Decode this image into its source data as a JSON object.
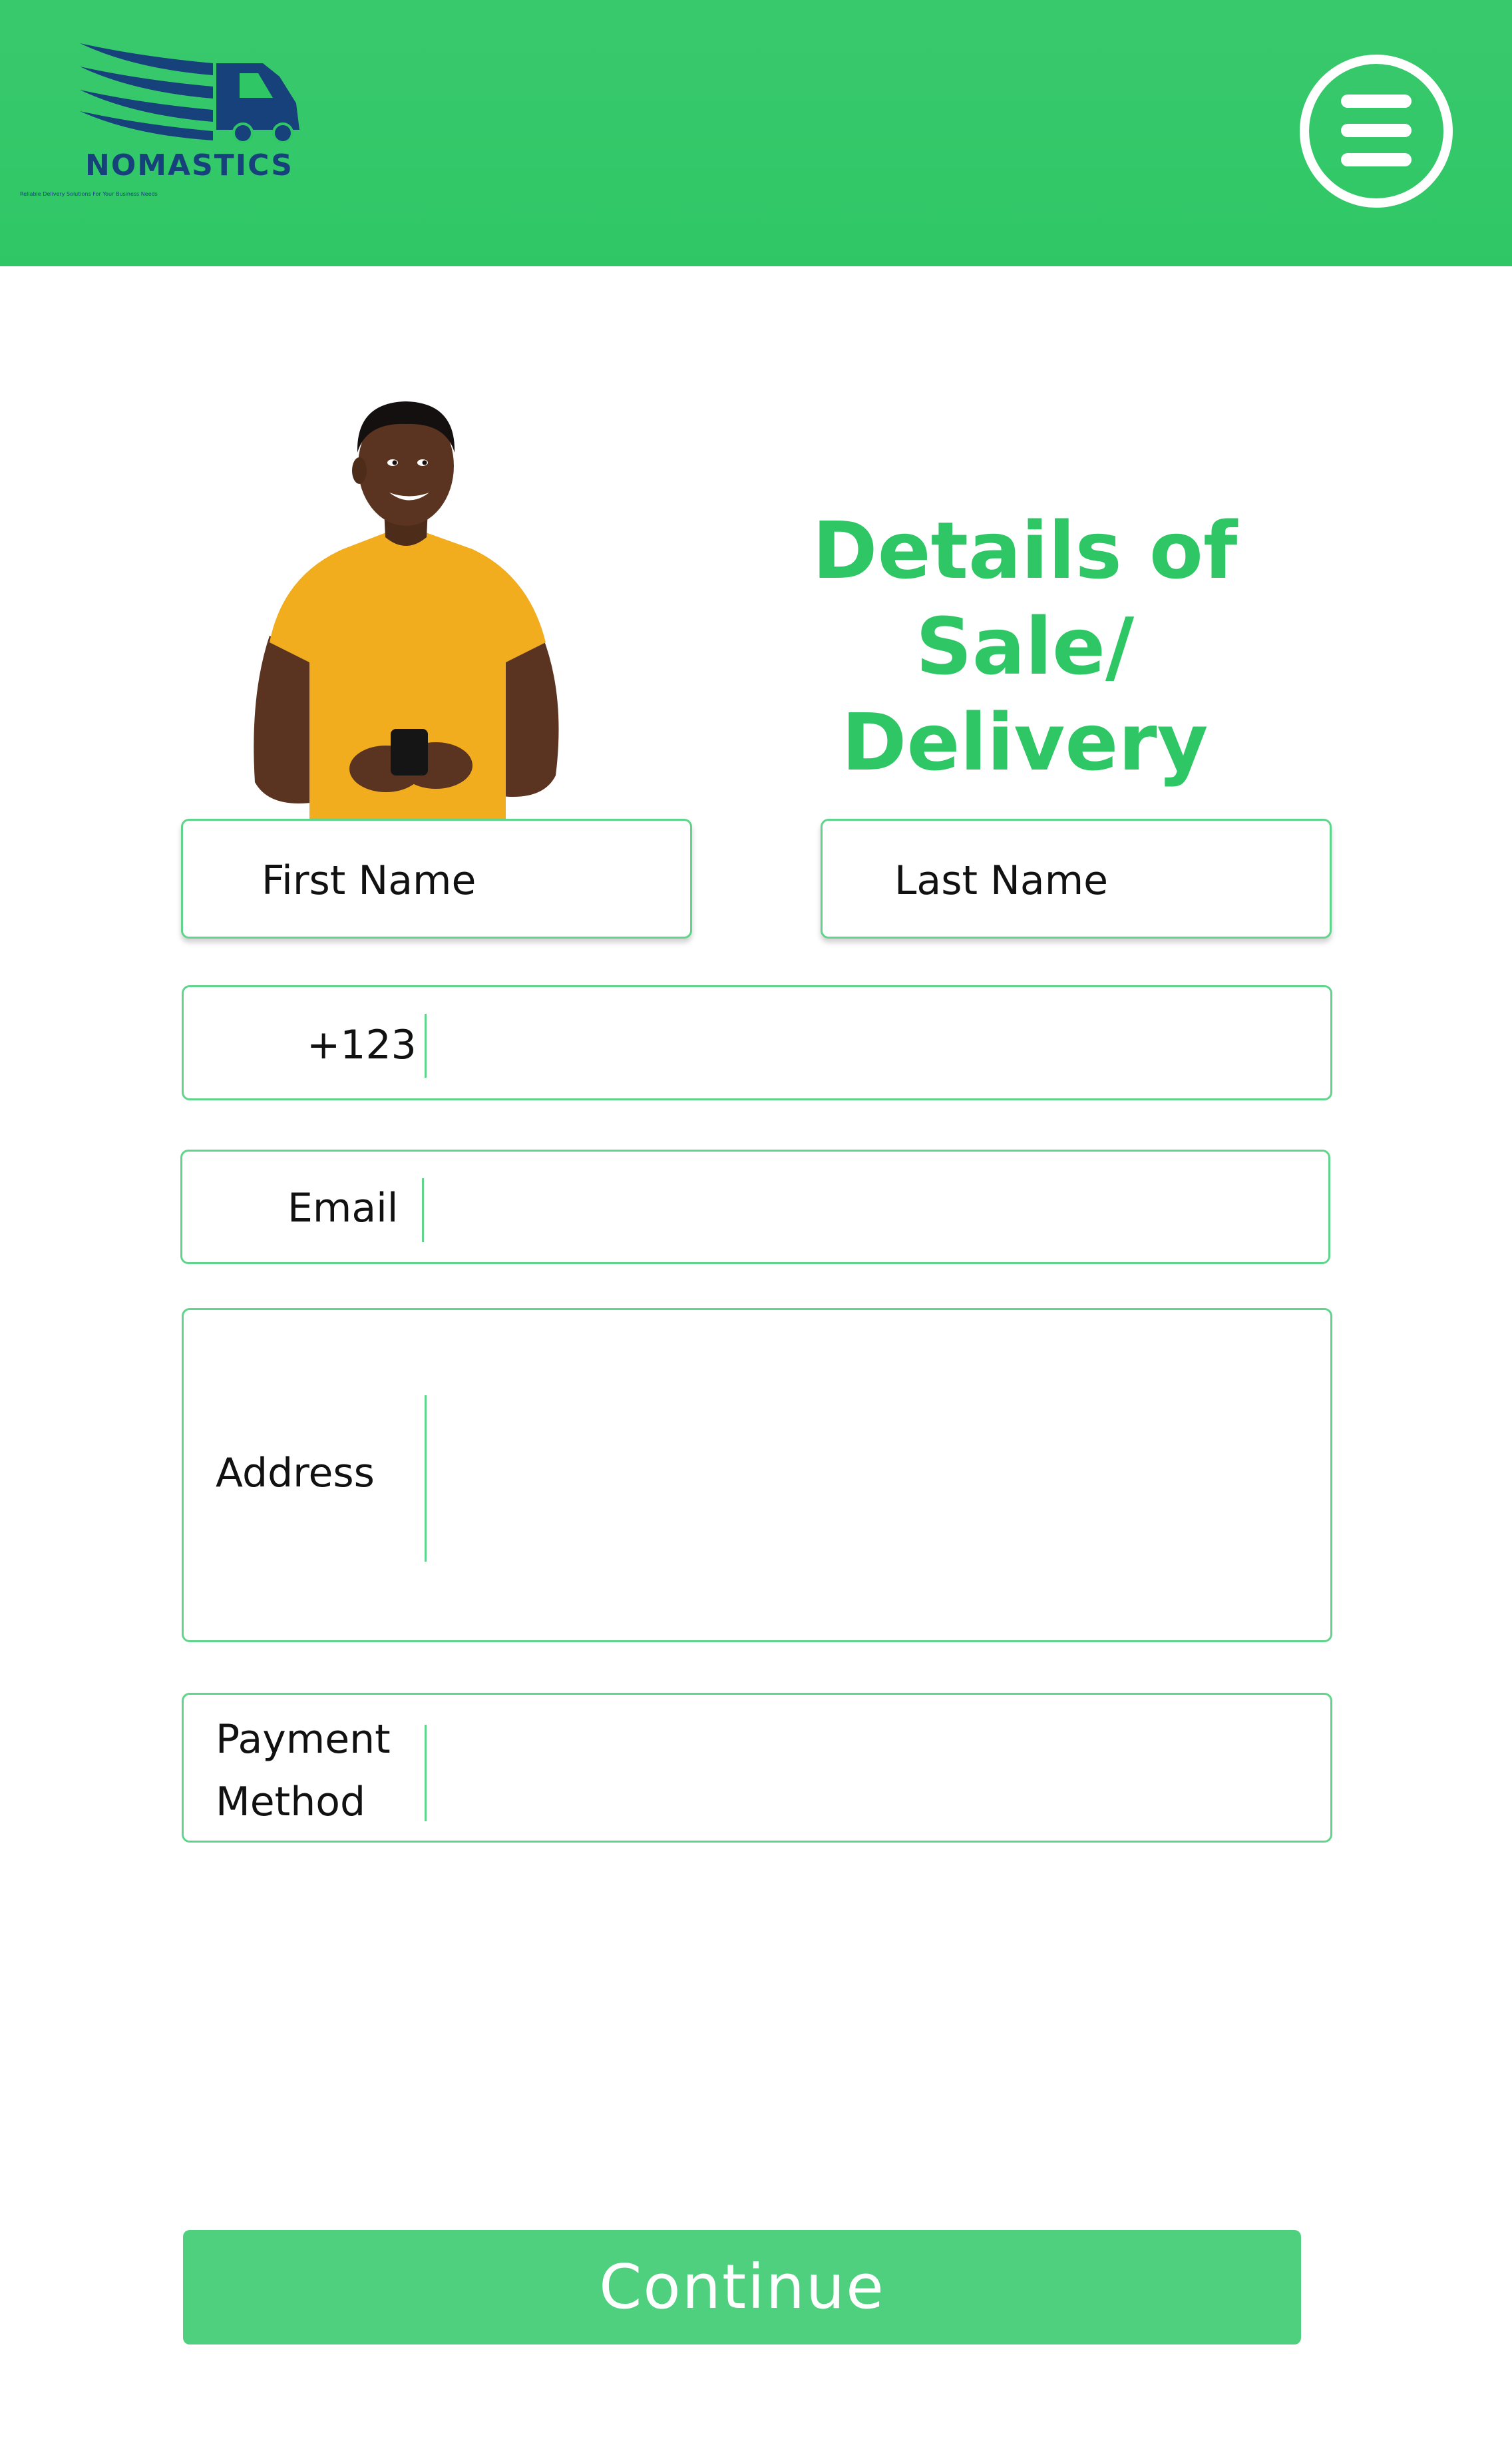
{
  "header": {
    "logo": {
      "name": "NOMASTICS",
      "tagline": "Reliable Delivery Solutions For Your Business Needs",
      "icon": "delivery-truck-icon",
      "color": "#17417b"
    },
    "menu_icon": "hamburger-menu-icon",
    "background_color": "#2fc766"
  },
  "hero": {
    "image": "smiling-man-holding-phone",
    "title_line1": "Details of Sale/",
    "title_line2": "Delivery",
    "title_color": "#2fc766"
  },
  "form": {
    "first_name_label": "First Name",
    "last_name_label": "Last Name",
    "phone_label": "+123",
    "email_label": "Email",
    "address_label": "Address",
    "payment_label_line1": "Payment",
    "payment_label_line2": "Method",
    "border_color": "#5fd48a"
  },
  "actions": {
    "continue_label": "Continue",
    "continue_color": "#4fd07f"
  }
}
